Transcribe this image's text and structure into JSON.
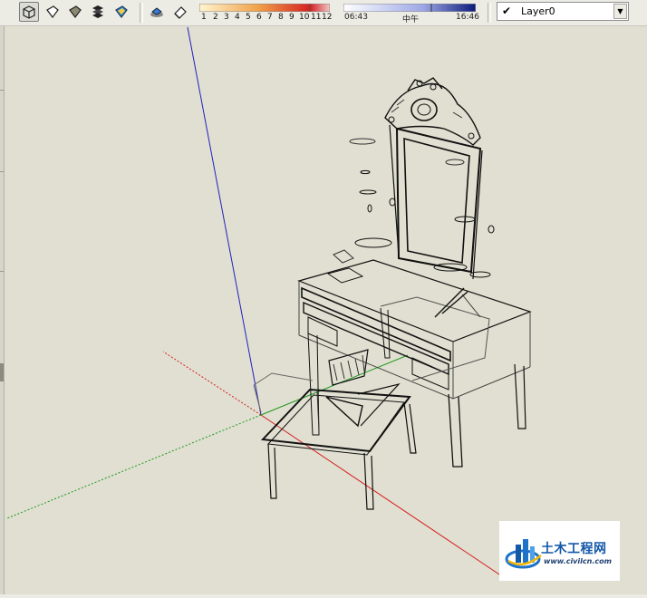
{
  "toolbar": {
    "tools": [
      {
        "icon": "xray-style-icon",
        "active": true
      },
      {
        "icon": "wireframe-style-icon"
      },
      {
        "icon": "shaded-style-icon"
      },
      {
        "icon": "layers-stack-icon"
      },
      {
        "icon": "shaded-texture-icon"
      },
      {
        "icon": "shadows-toggle-icon"
      },
      {
        "icon": "fog-eraser-icon"
      }
    ]
  },
  "light_scale": {
    "ticks": [
      "1",
      "2",
      "3",
      "4",
      "5",
      "6",
      "7",
      "8",
      "9",
      "10",
      "11",
      "12"
    ]
  },
  "time_of_day": {
    "start": "06:43",
    "middle": "中午",
    "end": "16:46"
  },
  "layer": {
    "name": "Layer0",
    "checked": true
  },
  "watermark": {
    "title": "土木工程网",
    "url": "www.civilcn.com"
  },
  "colors": {
    "background": "#e0dfd1",
    "axis_red": "#d42020",
    "axis_green": "#1f9a1f",
    "axis_blue": "#2020c0",
    "model_line": "#111111",
    "brand_blue": "#1459a8"
  }
}
